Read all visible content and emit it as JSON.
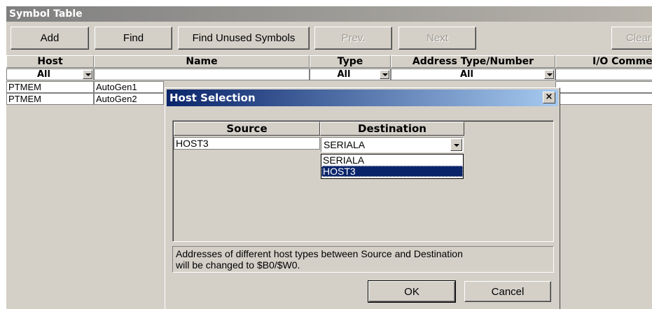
{
  "window": {
    "title": "Symbol Table"
  },
  "toolbar": {
    "add": "Add",
    "find": "Find",
    "find_unused": "Find Unused Symbols",
    "prev": "Prev.",
    "next": "Next",
    "clear": "Clear"
  },
  "table": {
    "headers": {
      "host": "Host",
      "name": "Name",
      "type": "Type",
      "address": "Address Type/Number",
      "io": "I/O Comment"
    },
    "filters": {
      "host": "All",
      "type": "All",
      "address": "All"
    },
    "rows": [
      {
        "host": "PTMEM",
        "name": "AutoGen1"
      },
      {
        "host": "PTMEM",
        "name": "AutoGen2"
      }
    ]
  },
  "dialog": {
    "title": "Host Selection",
    "close": "×",
    "source_header": "Source",
    "destination_header": "Destination",
    "source_value": "HOST3",
    "destination_value": "SERIALA",
    "options": [
      "SERIALA",
      "HOST3"
    ],
    "selected_option": 1,
    "note_line1": "Addresses of different host types between Source and Destination",
    "note_line2": "will be changed to $B0/$W0.",
    "ok": "OK",
    "cancel": "Cancel"
  },
  "colors": {
    "face": "#d4d0c8",
    "title_active": "#0a246a",
    "title_inactive": "#808080",
    "highlight": "#0a246a"
  }
}
